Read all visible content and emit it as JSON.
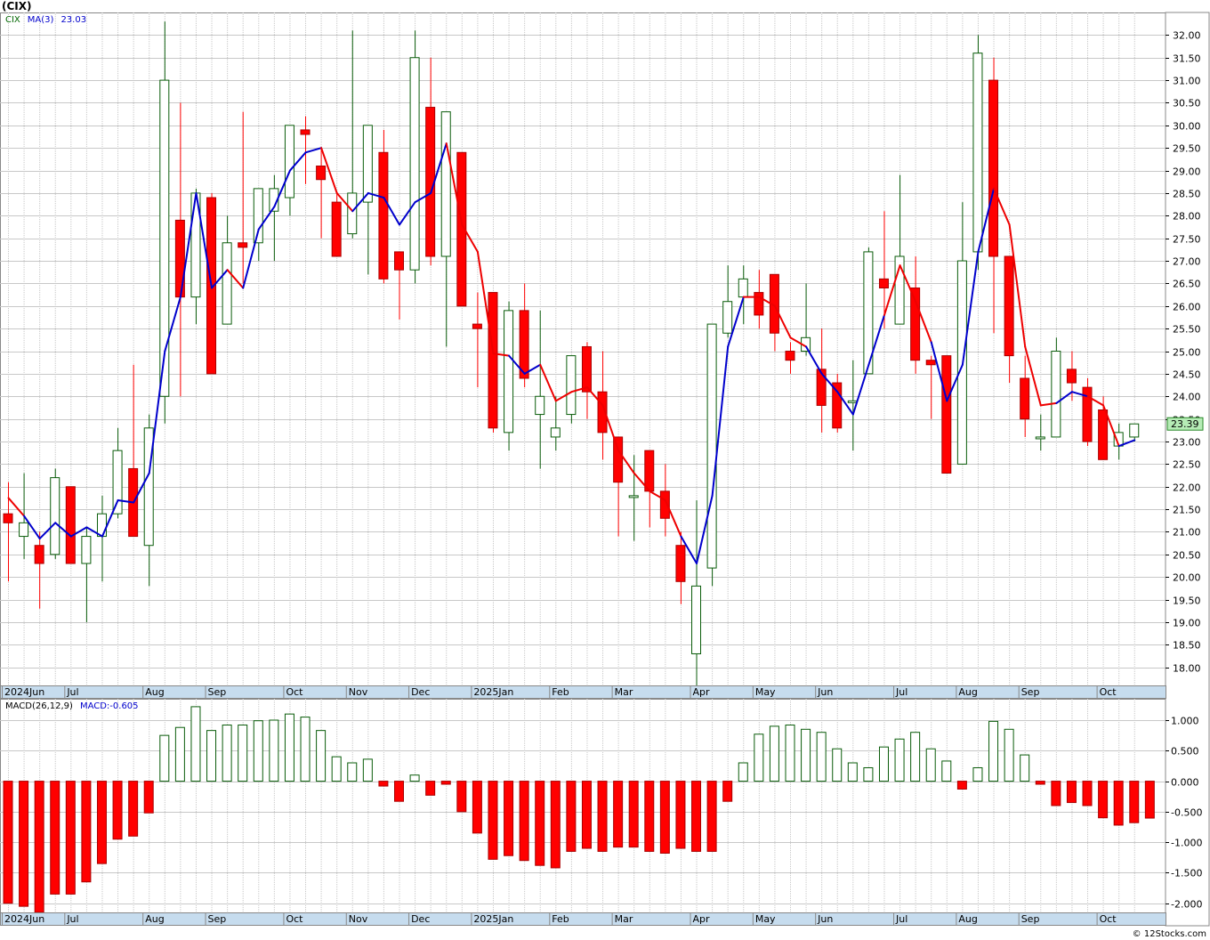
{
  "title": "(CIX)",
  "copyright": "© 12Stocks.com",
  "colors": {
    "up": "#0a5c0a",
    "down": "#ff0000",
    "ma_up": "#0000cc",
    "ma_down": "#ee0000",
    "grid": "#c8c8c8",
    "axis_bar": "#c6dcee",
    "current_price_box": "#b6ecb6"
  },
  "chart_data": [
    {
      "type": "candlestick",
      "timeframe": "weekly",
      "legend": [
        {
          "text": "CIX",
          "color": "#006600"
        },
        {
          "text": "MA(3)",
          "color": "#0000cc"
        },
        {
          "text": "23.03",
          "color": "#0000cc"
        }
      ],
      "current_price": "23.39",
      "ylim": [
        17.6,
        32.5
      ],
      "ticks": [
        "18.00",
        "18.50",
        "19.00",
        "19.50",
        "20.00",
        "20.50",
        "21.00",
        "21.50",
        "22.00",
        "22.50",
        "23.00",
        "23.50",
        "24.00",
        "24.50",
        "25.00",
        "25.50",
        "26.00",
        "26.50",
        "27.00",
        "27.50",
        "28.00",
        "28.50",
        "29.00",
        "29.50",
        "30.00",
        "30.50",
        "31.00",
        "31.50",
        "32.00"
      ],
      "month_labels": [
        {
          "label": "2024Jun",
          "week": 0
        },
        {
          "label": "Jul",
          "week": 4
        },
        {
          "label": "Aug",
          "week": 9
        },
        {
          "label": "Sep",
          "week": 13
        },
        {
          "label": "Oct",
          "week": 18
        },
        {
          "label": "Nov",
          "week": 22
        },
        {
          "label": "Dec",
          "week": 26
        },
        {
          "label": "2025Jan",
          "week": 30
        },
        {
          "label": "Feb",
          "week": 35
        },
        {
          "label": "Mar",
          "week": 39
        },
        {
          "label": "Apr",
          "week": 44
        },
        {
          "label": "May",
          "week": 48
        },
        {
          "label": "Jun",
          "week": 52
        },
        {
          "label": "Jul",
          "week": 57
        },
        {
          "label": "Aug",
          "week": 61
        },
        {
          "label": "Sep",
          "week": 65
        },
        {
          "label": "Oct",
          "week": 70
        }
      ],
      "candles": [
        {
          "o": 21.4,
          "h": 22.1,
          "l": 19.9,
          "c": 21.2
        },
        {
          "o": 20.9,
          "h": 22.3,
          "l": 20.4,
          "c": 21.2
        },
        {
          "o": 20.7,
          "h": 21.0,
          "l": 19.3,
          "c": 20.3
        },
        {
          "o": 20.5,
          "h": 22.4,
          "l": 20.4,
          "c": 22.2
        },
        {
          "o": 22.0,
          "h": 22.0,
          "l": 20.3,
          "c": 20.3
        },
        {
          "o": 20.3,
          "h": 21.1,
          "l": 19.0,
          "c": 20.9
        },
        {
          "o": 20.9,
          "h": 21.8,
          "l": 19.9,
          "c": 21.4
        },
        {
          "o": 21.4,
          "h": 23.3,
          "l": 21.3,
          "c": 22.8
        },
        {
          "o": 22.4,
          "h": 24.7,
          "l": 20.9,
          "c": 20.9
        },
        {
          "o": 20.7,
          "h": 23.6,
          "l": 19.8,
          "c": 23.3
        },
        {
          "o": 24.0,
          "h": 32.3,
          "l": 23.4,
          "c": 31.0
        },
        {
          "o": 27.9,
          "h": 30.5,
          "l": 24.0,
          "c": 26.2
        },
        {
          "o": 26.2,
          "h": 28.6,
          "l": 25.6,
          "c": 28.5
        },
        {
          "o": 28.4,
          "h": 28.5,
          "l": 24.5,
          "c": 24.5
        },
        {
          "o": 25.6,
          "h": 28.0,
          "l": 25.6,
          "c": 27.4
        },
        {
          "o": 27.4,
          "h": 30.3,
          "l": 26.5,
          "c": 27.3
        },
        {
          "o": 27.4,
          "h": 28.6,
          "l": 27.0,
          "c": 28.6
        },
        {
          "o": 28.1,
          "h": 28.9,
          "l": 27.0,
          "c": 28.6
        },
        {
          "o": 28.4,
          "h": 30.0,
          "l": 28.0,
          "c": 30.0
        },
        {
          "o": 29.9,
          "h": 30.2,
          "l": 28.7,
          "c": 29.8
        },
        {
          "o": 29.1,
          "h": 29.5,
          "l": 27.5,
          "c": 28.8
        },
        {
          "o": 28.3,
          "h": 28.5,
          "l": 27.1,
          "c": 27.1
        },
        {
          "o": 27.6,
          "h": 32.1,
          "l": 27.5,
          "c": 28.5
        },
        {
          "o": 28.3,
          "h": 30.0,
          "l": 26.7,
          "c": 30.0
        },
        {
          "o": 29.4,
          "h": 29.9,
          "l": 26.5,
          "c": 26.6
        },
        {
          "o": 27.2,
          "h": 27.2,
          "l": 25.7,
          "c": 26.8
        },
        {
          "o": 26.8,
          "h": 32.1,
          "l": 26.5,
          "c": 31.5
        },
        {
          "o": 30.4,
          "h": 31.5,
          "l": 26.9,
          "c": 27.1
        },
        {
          "o": 27.1,
          "h": 30.3,
          "l": 25.1,
          "c": 30.3
        },
        {
          "o": 29.4,
          "h": 29.4,
          "l": 26.0,
          "c": 26.0
        },
        {
          "o": 25.6,
          "h": 26.3,
          "l": 24.2,
          "c": 25.5
        },
        {
          "o": 26.3,
          "h": 26.3,
          "l": 23.2,
          "c": 23.3
        },
        {
          "o": 23.2,
          "h": 26.1,
          "l": 22.8,
          "c": 25.9
        },
        {
          "o": 25.9,
          "h": 26.5,
          "l": 24.2,
          "c": 24.4
        },
        {
          "o": 23.6,
          "h": 25.9,
          "l": 22.4,
          "c": 24.0
        },
        {
          "o": 23.1,
          "h": 24.0,
          "l": 22.8,
          "c": 23.3
        },
        {
          "o": 23.6,
          "h": 24.9,
          "l": 23.4,
          "c": 24.9
        },
        {
          "o": 25.1,
          "h": 25.2,
          "l": 23.5,
          "c": 24.1
        },
        {
          "o": 24.1,
          "h": 25.0,
          "l": 22.6,
          "c": 23.2
        },
        {
          "o": 23.1,
          "h": 23.1,
          "l": 20.9,
          "c": 22.1
        },
        {
          "o": 21.8,
          "h": 22.7,
          "l": 20.8,
          "c": 21.8
        },
        {
          "o": 22.8,
          "h": 22.8,
          "l": 21.1,
          "c": 21.9
        },
        {
          "o": 21.9,
          "h": 22.5,
          "l": 20.9,
          "c": 21.3
        },
        {
          "o": 20.7,
          "h": 21.0,
          "l": 19.4,
          "c": 19.9
        },
        {
          "o": 18.3,
          "h": 21.7,
          "l": 17.6,
          "c": 19.8
        },
        {
          "o": 20.2,
          "h": 25.6,
          "l": 19.8,
          "c": 25.6
        },
        {
          "o": 25.4,
          "h": 26.9,
          "l": 25.3,
          "c": 26.1
        },
        {
          "o": 26.2,
          "h": 26.9,
          "l": 25.6,
          "c": 26.6
        },
        {
          "o": 26.3,
          "h": 26.8,
          "l": 25.5,
          "c": 25.8
        },
        {
          "o": 26.7,
          "h": 26.7,
          "l": 25.0,
          "c": 25.4
        },
        {
          "o": 25.0,
          "h": 25.2,
          "l": 24.5,
          "c": 24.8
        },
        {
          "o": 25.0,
          "h": 26.5,
          "l": 24.9,
          "c": 25.3
        },
        {
          "o": 24.6,
          "h": 25.5,
          "l": 23.2,
          "c": 23.8
        },
        {
          "o": 24.3,
          "h": 24.5,
          "l": 23.2,
          "c": 23.3
        },
        {
          "o": 23.9,
          "h": 24.8,
          "l": 22.8,
          "c": 23.9
        },
        {
          "o": 24.5,
          "h": 27.3,
          "l": 24.5,
          "c": 27.2
        },
        {
          "o": 26.6,
          "h": 28.1,
          "l": 25.5,
          "c": 26.4
        },
        {
          "o": 25.6,
          "h": 28.9,
          "l": 25.6,
          "c": 27.1
        },
        {
          "o": 26.4,
          "h": 27.1,
          "l": 24.5,
          "c": 24.8
        },
        {
          "o": 24.8,
          "h": 24.9,
          "l": 23.5,
          "c": 24.7
        },
        {
          "o": 24.9,
          "h": 24.9,
          "l": 22.3,
          "c": 22.3
        },
        {
          "o": 22.5,
          "h": 28.3,
          "l": 22.5,
          "c": 27.0
        },
        {
          "o": 27.2,
          "h": 32.0,
          "l": 26.8,
          "c": 31.6
        },
        {
          "o": 31.0,
          "h": 31.5,
          "l": 25.4,
          "c": 27.1
        },
        {
          "o": 27.1,
          "h": 27.1,
          "l": 24.3,
          "c": 24.9
        },
        {
          "o": 24.4,
          "h": 24.9,
          "l": 23.1,
          "c": 23.5
        },
        {
          "o": 23.1,
          "h": 23.6,
          "l": 22.8,
          "c": 23.1
        },
        {
          "o": 23.1,
          "h": 25.3,
          "l": 23.1,
          "c": 25.0
        },
        {
          "o": 24.6,
          "h": 25.0,
          "l": 23.9,
          "c": 24.3
        },
        {
          "o": 24.2,
          "h": 24.4,
          "l": 22.9,
          "c": 23.0
        },
        {
          "o": 23.7,
          "h": 24.0,
          "l": 22.6,
          "c": 22.6
        },
        {
          "o": 22.9,
          "h": 23.4,
          "l": 22.6,
          "c": 23.2
        },
        {
          "o": 23.1,
          "h": 23.4,
          "l": 23.0,
          "c": 23.39
        }
      ],
      "ma3": [
        21.75,
        21.35,
        20.85,
        21.2,
        20.9,
        21.1,
        20.9,
        21.7,
        21.65,
        22.3,
        25.0,
        26.2,
        28.5,
        26.4,
        26.8,
        26.4,
        27.7,
        28.2,
        29.0,
        29.4,
        29.5,
        28.5,
        28.1,
        28.5,
        28.4,
        27.8,
        28.3,
        28.5,
        29.6,
        27.8,
        27.2,
        24.95,
        24.9,
        24.5,
        24.7,
        23.9,
        24.1,
        24.2,
        23.8,
        22.8,
        22.3,
        21.9,
        21.7,
        20.9,
        20.3,
        21.8,
        25.1,
        26.2,
        26.2,
        26.0,
        25.3,
        25.1,
        24.5,
        24.1,
        23.6,
        24.7,
        25.8,
        26.9,
        26.1,
        25.2,
        23.9,
        24.7,
        27.2,
        28.6,
        27.8,
        25.1,
        23.8,
        23.85,
        24.1,
        24.0,
        23.8,
        22.9,
        23.03
      ],
      "ma3_colors": "rrbbbbbbbbbbbbbrbbbbbrrbbbbbbrrrrbbrrrrrrrrrbbbbrrrrbbbbbrrrbbbbrrrrbbrrbb"
    },
    {
      "type": "bar",
      "name": "MACD(26,12,9)",
      "legend": [
        {
          "text": "MACD(26,12,9)",
          "color": "#000000"
        },
        {
          "text": "MACD:-0.605",
          "color": "#0000cc"
        }
      ],
      "ylim": [
        -2.15,
        1.35
      ],
      "ticks": [
        "1.000",
        "0.500",
        "0.000",
        "-0.500",
        "-1.000",
        "-1.500",
        "-2.000"
      ],
      "values": [
        -2.0,
        -2.05,
        -2.15,
        -1.85,
        -1.85,
        -1.65,
        -1.35,
        -0.95,
        -0.9,
        -0.52,
        0.75,
        0.88,
        1.22,
        0.83,
        0.92,
        0.92,
        0.99,
        1.0,
        1.1,
        1.05,
        0.83,
        0.4,
        0.3,
        0.36,
        -0.08,
        -0.33,
        0.1,
        -0.23,
        -0.05,
        -0.5,
        -0.85,
        -1.28,
        -1.22,
        -1.3,
        -1.38,
        -1.42,
        -1.15,
        -1.1,
        -1.15,
        -1.08,
        -1.08,
        -1.15,
        -1.18,
        -1.1,
        -1.15,
        -1.15,
        -0.33,
        0.3,
        0.77,
        0.9,
        0.92,
        0.85,
        0.8,
        0.53,
        0.3,
        0.22,
        0.56,
        0.69,
        0.8,
        0.53,
        0.33,
        -0.13,
        0.22,
        0.98,
        0.85,
        0.43,
        -0.05,
        -0.4,
        -0.35,
        -0.4,
        -0.6,
        -0.72,
        -0.68,
        -0.605
      ]
    }
  ]
}
